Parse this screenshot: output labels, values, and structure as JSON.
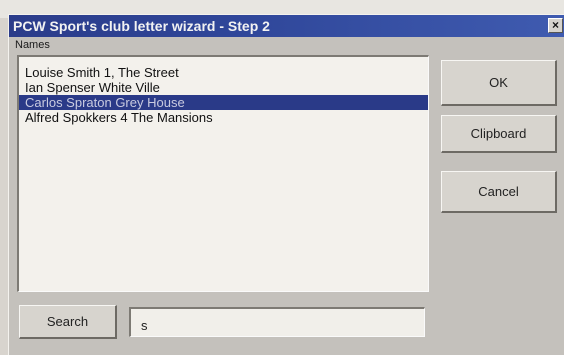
{
  "window": {
    "title": "PCW Sport's club letter wizard - Step 2",
    "close_glyph": "×"
  },
  "names": {
    "label": "Names",
    "items": [
      {
        "text": "Louise Smith 1, The Street",
        "selected": false
      },
      {
        "text": "Ian Spenser White Ville",
        "selected": false
      },
      {
        "text": "Carlos Spraton Grey House",
        "selected": true
      },
      {
        "text": "Alfred Spokkers 4 The Mansions",
        "selected": false
      }
    ]
  },
  "buttons": {
    "ok": "OK",
    "clipboard": "Clipboard",
    "cancel": "Cancel",
    "search": "Search"
  },
  "search": {
    "value": "s"
  },
  "colors": {
    "titlebar": "#2f4699",
    "selection": "#2a3a88",
    "dialog_face": "#c4c1bc"
  }
}
